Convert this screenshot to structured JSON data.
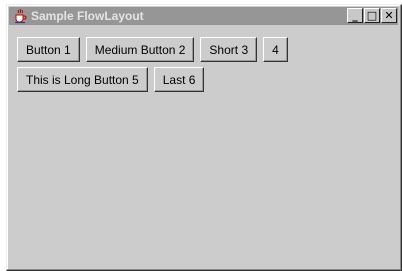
{
  "window": {
    "title": "Sample FlowLayout",
    "controls": {
      "minimize": "_",
      "maximize": "□",
      "close": "✕"
    },
    "app_icon": "java-cup-icon"
  },
  "buttons": {
    "row1": [
      "Button 1",
      "Medium Button 2",
      "Short 3",
      "4"
    ],
    "row2": [
      "This is Long Button 5",
      "Last 6"
    ]
  },
  "colors": {
    "titlebar_inactive": "#969696",
    "window_bg": "#cccccc",
    "title_text": "#e4e4e4"
  }
}
